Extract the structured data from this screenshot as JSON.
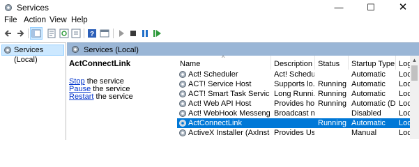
{
  "window": {
    "title": "Services",
    "min_glyph": "—",
    "max_glyph": "☐",
    "close_glyph": "✕"
  },
  "menu": [
    "File",
    "Action",
    "View",
    "Help"
  ],
  "left_pane": {
    "tree_item": "Services (Local)"
  },
  "header_band": {
    "label": "Services (Local)"
  },
  "detail": {
    "service_name": "ActConnectLink",
    "stop_link": "Stop",
    "stop_rest": " the service",
    "pause_link": "Pause",
    "pause_rest": " the service",
    "restart_link": "Restart",
    "restart_rest": " the service"
  },
  "columns": [
    "Name",
    "Description",
    "Status",
    "Startup Type",
    "Log"
  ],
  "rows": [
    {
      "name": "Act! Scheduler",
      "description": "Act! Schedu...",
      "status": "",
      "startup": "Automatic",
      "log": "Loc",
      "selected": false
    },
    {
      "name": "ACT! Service Host",
      "description": "Supports lo...",
      "status": "Running",
      "startup": "Automatic",
      "log": "Loc",
      "selected": false
    },
    {
      "name": "ACT! Smart Task Service Host",
      "description": "Long Runni...",
      "status": "Running",
      "startup": "Automatic",
      "log": "Loc",
      "selected": false
    },
    {
      "name": "Act! Web API Host",
      "description": "Provides ho...",
      "status": "Running",
      "startup": "Automatic (D...",
      "log": "Loc",
      "selected": false
    },
    {
      "name": "Act! WebHook Messenger",
      "description": "Broadcast n...",
      "status": "",
      "startup": "Disabled",
      "log": "Loc",
      "selected": false
    },
    {
      "name": "ActConnectLink",
      "description": "",
      "status": "Running",
      "startup": "Automatic",
      "log": "Loc",
      "selected": true
    },
    {
      "name": "ActiveX Installer (AxInstSV)",
      "description": "Provides Us...",
      "status": "",
      "startup": "Manual",
      "log": "Loc",
      "selected": false
    }
  ],
  "colors": {
    "selection": "#0078d7",
    "header_band": "#9ab6d6",
    "link": "#0033cc"
  }
}
